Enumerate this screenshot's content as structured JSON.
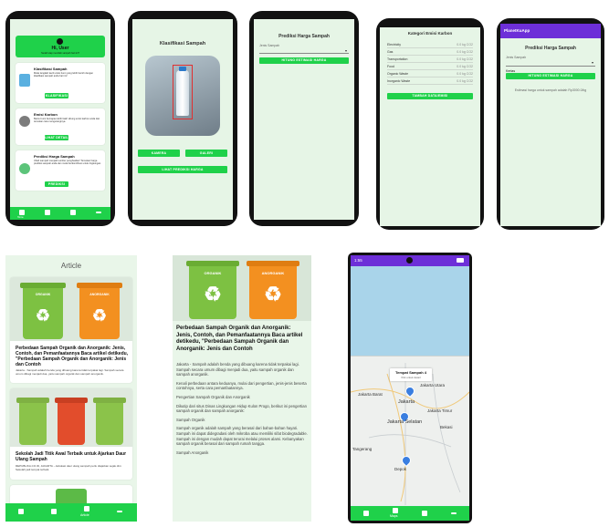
{
  "home": {
    "greeting": "Hi, User",
    "sub": "Sudah siap memilah sampah hari ini?",
    "cards": [
      {
        "title": "Klasifikasi Sampah",
        "desc": "Mulai langkah kecil untuk bumi yang lebih bersih dengan klasifikasi sampah anda hari ini!",
        "button": "KLASIFIKASI"
      },
      {
        "title": "Emisi Karbon",
        "desc": "Bantu bumi bernapas lebih baik! Hitung emisi karbon anda dan temukan cara menguranginya.",
        "button": "LIHAT DETAIL"
      },
      {
        "title": "Prediksi Harga Sampah",
        "desc": "Ubah sampah menjadi sumber penghasilan! Temukan harga prediksi sampah anda dan mulai berkontribusi untuk lingkungan.",
        "button": "PREDIKSI"
      }
    ],
    "nav_active": "Home"
  },
  "klasifikasi": {
    "title": "Klasifikasi Sampah",
    "kamera": "KAMERA",
    "galeri": "GALERI",
    "prediksi": "LIHAT PREDIKSI HARGA"
  },
  "prediksi1": {
    "title": "Prediksi Harga Sampah",
    "label": "Jenis Sampah",
    "value": "Plastik",
    "button": "HITUNG ESTIMASI HARGA"
  },
  "emisi": {
    "title": "Kategori Emisi Karbon",
    "rows": [
      {
        "name": "Electricity",
        "unit": "0.0 kg CO2"
      },
      {
        "name": "Gas",
        "unit": "0.0 kg CO2"
      },
      {
        "name": "Transportation",
        "unit": "0.0 kg CO2"
      },
      {
        "name": "Food",
        "unit": "0.0 kg CO2"
      },
      {
        "name": "Organic Waste",
        "unit": "0.0 kg CO2"
      },
      {
        "name": "Inorganic Waste",
        "unit": "0.0 kg CO2"
      }
    ],
    "button": "TAMBAH DATA/EMISI"
  },
  "prediksi2": {
    "app": "PlanetKuApp",
    "title": "Prediksi Harga Sampah",
    "label": "Jenis Sampah",
    "value": "Kertas",
    "button": "HITUNG ESTIMASI HARGA",
    "result": "Estimasi harga untuk sampah adalah Rp3000.0/kg"
  },
  "article_list": {
    "title": "Article",
    "items": [
      {
        "title": "Perbedaan Sampah Organik dan Anorganik: Jenis, Contoh, dan Pemanfaatannya Baca artikel detikedu, \"Perbedaan Sampah Organik dan Anorganik: Jenis dan Contoh",
        "snippet": "Jakarta - Sampah adalah benda yang dibuang karena tidak terpakai lagi. Sampah secara umum dibagi menjadi dua, yaitu sampah organik dan sampah anorganik."
      },
      {
        "title": "Sekolah Jadi Titik Awal Terbaik untuk Ajarkan Daur Ulang Sampah",
        "snippet": "REPUBLIKA.CO.ID, JAKARTA -- Edukasi daur ulang sampah perlu diajarkan sejak dini. Sekolah jadi tempat terbaik."
      }
    ],
    "nav_active": "Article"
  },
  "article_detail": {
    "title": "Perbedaan Sampah Organik dan Anorganik: Jenis, Contoh, dan Pemanfaatannya Baca artikel detikedu, \"Perbedaan Sampah Organik dan Anorganik: Jenis dan Contoh",
    "paragraphs": [
      "Jakarta - Sampah adalah benda yang dibuang karena tidak terpakai lagi. Sampah secara umum dibagi menjadi dua, yaitu sampah organik dan sampah anorganik.",
      "Kenali perbedaan antara keduanya, mulai dari pengertian, jenis-jenis beserta contohnya, serta cara pemanfaatannya.",
      "Pengertian Sampah Organik dan Anorganik",
      "Dikutip dari situs Dinas Lingkungan Hidup Kulon Progo, berikut ini pengertian sampah organik dan sampah anorganik:",
      "Sampah Organik",
      "Sampah organik adalah sampah yang berasal dari bahan-bahan hayati. Sampah ini dapat didegradasi oleh mikroba atau memiliki sifat biodegradable. Sampah ini dengan mudah dapat terurai melalui proses alami. Kebanyakan sampah organik berasal dari sampah rumah tangga.",
      "Sampah Anorganik"
    ],
    "bin_labels": [
      "ORGANIK",
      "ANORGANIK"
    ]
  },
  "map": {
    "time": "1:55",
    "popup_title": "Tempat Sampah 4",
    "popup_sub": "Klik untuk detail",
    "labels": [
      "Jakarta Barat",
      "Jakarta",
      "Jakarta Selatan",
      "Depok",
      "Bekasi",
      "Tangerang",
      "Jakarta Timur",
      "Jakarta Utara"
    ],
    "nav_active": "Maps"
  },
  "bins": {
    "organik": "ORGANIK",
    "anorganik": "ANORGANIK"
  },
  "nav": {
    "home": "Home",
    "article": "Article",
    "maps": "Maps",
    "more": "More"
  }
}
